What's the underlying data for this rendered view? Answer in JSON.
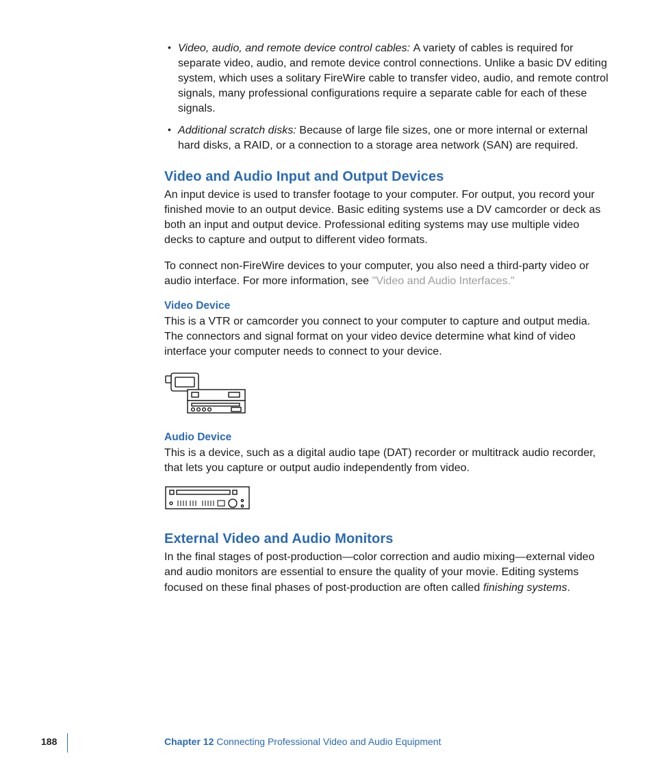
{
  "bullets": [
    {
      "lead": "Video, audio, and remote device control cables:  ",
      "rest": "A variety of cables is required for separate video, audio, and remote device control connections. Unlike a basic DV editing system, which uses a solitary FireWire cable to transfer video, audio, and remote control signals, many professional configurations require a separate cable for each of these signals."
    },
    {
      "lead": "Additional scratch disks:  ",
      "rest": "Because of large file sizes, one or more internal or external hard disks, a RAID, or a connection to a storage area network (SAN) are required."
    }
  ],
  "section1": {
    "title": "Video and Audio Input and Output Devices",
    "p1": "An input device is used to transfer footage to your computer. For output, you record your finished movie to an output device. Basic editing systems use a DV camcorder or deck as both an input and output device. Professional editing systems may use multiple video decks to capture and output to different video formats.",
    "p2a": "To connect non-FireWire devices to your computer, you also need a third-party video or audio interface. For more information, see ",
    "p2_xref": "\"Video and Audio Interfaces.\"",
    "sub1_title": "Video Device",
    "sub1_body": "This is a VTR or camcorder you connect to your computer to capture and output media. The connectors and signal format on your video device determine what kind of video interface your computer needs to connect to your device.",
    "sub2_title": "Audio Device",
    "sub2_body": "This is a device, such as a digital audio tape (DAT) recorder or multitrack audio recorder, that lets you capture or output audio independently from video."
  },
  "section2": {
    "title": "External Video and Audio Monitors",
    "p1a": "In the final stages of post-production—color correction and audio mixing—external video and audio monitors are essential to ensure the quality of your movie. Editing systems focused on these final phases of post-production are often called ",
    "p1_em": "finishing systems",
    "p1b": "."
  },
  "footer": {
    "page": "188",
    "chapter_label": "Chapter 12",
    "chapter_title": "    Connecting Professional Video and Audio Equipment"
  }
}
